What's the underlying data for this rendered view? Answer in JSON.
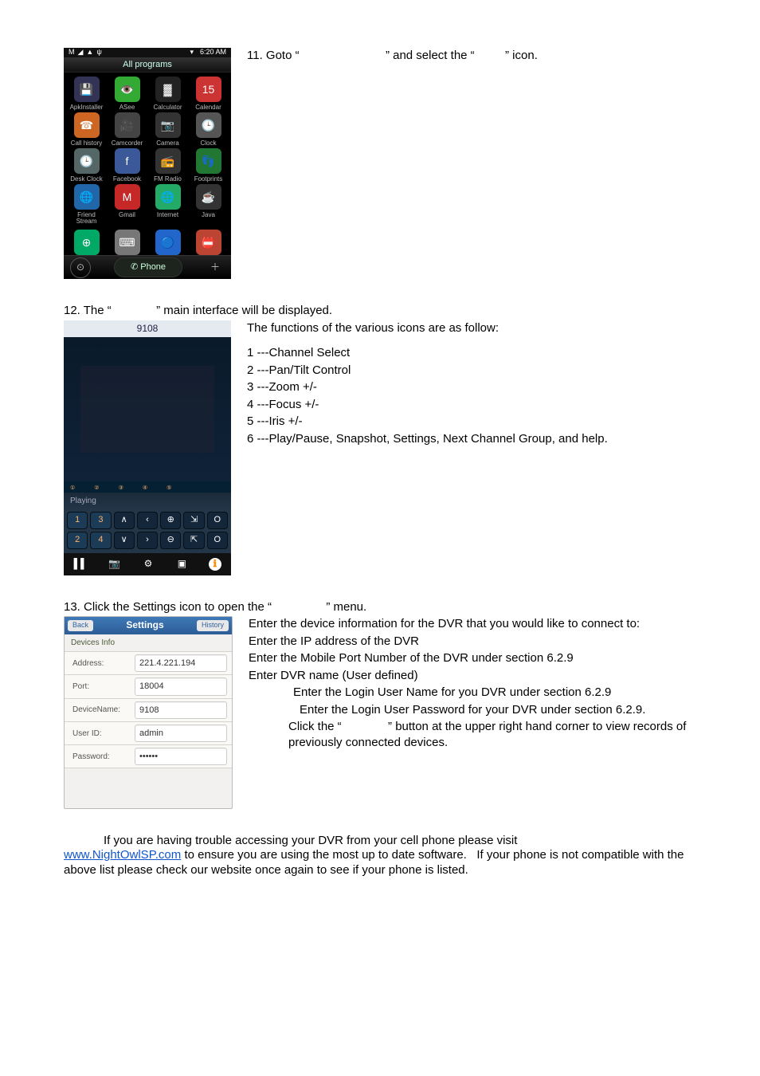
{
  "step11": {
    "text_a": "11. Goto “",
    "text_b": "” and select the “",
    "text_c": "” icon."
  },
  "android": {
    "status_time": "6:20 AM",
    "header": "All programs",
    "apps": [
      {
        "label": "ApkInstaller",
        "icon": "💾",
        "bg": "#335"
      },
      {
        "label": "ASee",
        "icon": "👁️",
        "bg": "#3a3"
      },
      {
        "label": "Calculator",
        "icon": "▓",
        "bg": "#222"
      },
      {
        "label": "Calendar",
        "icon": "15",
        "bg": "#c33"
      },
      {
        "label": "Call history",
        "icon": "☎",
        "bg": "#c62"
      },
      {
        "label": "Camcorder",
        "icon": "🎥",
        "bg": "#444"
      },
      {
        "label": "Camera",
        "icon": "📷",
        "bg": "#333"
      },
      {
        "label": "Clock",
        "icon": "🕒",
        "bg": "#555"
      },
      {
        "label": "Desk Clock",
        "icon": "🕒",
        "bg": "#566"
      },
      {
        "label": "Facebook",
        "icon": "f",
        "bg": "#3b5998"
      },
      {
        "label": "FM Radio",
        "icon": "📻",
        "bg": "#333"
      },
      {
        "label": "Footprints",
        "icon": "👣",
        "bg": "#273"
      },
      {
        "label": "Friend Stream",
        "icon": "🌐",
        "bg": "#26a"
      },
      {
        "label": "Gmail",
        "icon": "M",
        "bg": "#c62828"
      },
      {
        "label": "Internet",
        "icon": "🌐",
        "bg": "#2a6"
      },
      {
        "label": "Java",
        "icon": "☕",
        "bg": "#333"
      }
    ],
    "row5": [
      {
        "icon": "⊕",
        "bg": "#0a6"
      },
      {
        "icon": "⌨",
        "bg": "#777"
      },
      {
        "icon": "🔵",
        "bg": "#26c"
      },
      {
        "icon": "📛",
        "bg": "#b43"
      }
    ],
    "dock_phone": "Phone"
  },
  "step12": {
    "text_a": "12. The “",
    "text_b": "” main interface will be displayed.",
    "subtitle": "The functions of the various icons are as follow:",
    "items": [
      "1 ---Channel Select",
      "2 ---Pan/Tilt Control",
      "3 ---Zoom +/-",
      "4 ---Focus +/-",
      "5 ---Iris +/-",
      "6 ---Play/Pause, Snapshot, Settings, Next Channel Group, and help."
    ]
  },
  "asee": {
    "title": "9108",
    "playing": "Playing",
    "nums_top": [
      "①",
      "②",
      "③",
      "④",
      "⑤"
    ],
    "row1": [
      "1",
      "3",
      "∧",
      "‹",
      "⊕",
      "⇲",
      "O"
    ],
    "row2": [
      "2",
      "4",
      "∨",
      "›",
      "⊖",
      "⇱",
      "O"
    ],
    "bot": [
      "▌▌",
      "📷",
      "⚙",
      "▣",
      "ℹ"
    ]
  },
  "step13": {
    "text_a": "13. Click the Settings icon to open the “",
    "text_b": "” menu.",
    "intro": "Enter the device information for the DVR that you would like to connect to:",
    "lines": [
      "Enter the IP address of the DVR",
      "Enter the Mobile Port Number of the DVR under section 6.2.9",
      "Enter DVR name (User defined)",
      "Enter the Login User Name for you DVR under section 6.2.9",
      "Enter the Login User Password for your DVR under section 6.2.9.",
      "Click the “",
      "” button at the upper right hand corner to view records of previously connected devices."
    ]
  },
  "settings": {
    "hdr_left": "Back",
    "hdr_center": "Settings",
    "hdr_right": "History",
    "section": "Devices Info",
    "rows": [
      {
        "k": "Address:",
        "v": "221.4.221.194"
      },
      {
        "k": "Port:",
        "v": "18004"
      },
      {
        "k": "DeviceName:",
        "v": "9108"
      },
      {
        "k": "User ID:",
        "v": "admin"
      },
      {
        "k": "Password:",
        "v": "••••••"
      }
    ]
  },
  "note": {
    "l1a": "If you are having trouble accessing your DVR from your cell phone please visit ",
    "link": "www.NightOwlSP.com",
    "l1b": " to ensure you are using the most up to date software.   If your phone is not compatible with the above list please check our website once again to see if your phone is listed."
  }
}
